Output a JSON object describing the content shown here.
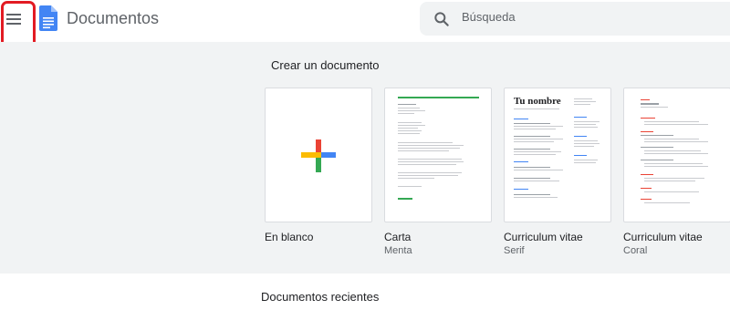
{
  "header": {
    "app_title": "Documentos",
    "search_placeholder": "Búsqueda"
  },
  "gallery": {
    "title": "Crear un documento",
    "templates": [
      {
        "name": "En blanco",
        "subtitle": ""
      },
      {
        "name": "Carta",
        "subtitle": "Menta"
      },
      {
        "name": "Curriculum vitae",
        "subtitle": "Serif",
        "thumb_heading": "Tu nombre"
      },
      {
        "name": "Curriculum vitae",
        "subtitle": "Coral"
      }
    ]
  },
  "recent": {
    "title": "Documentos recientes"
  },
  "colors": {
    "highlight": "#e21b23",
    "docs_blue": "#4285f4",
    "gallery_bg": "#f1f3f4"
  }
}
